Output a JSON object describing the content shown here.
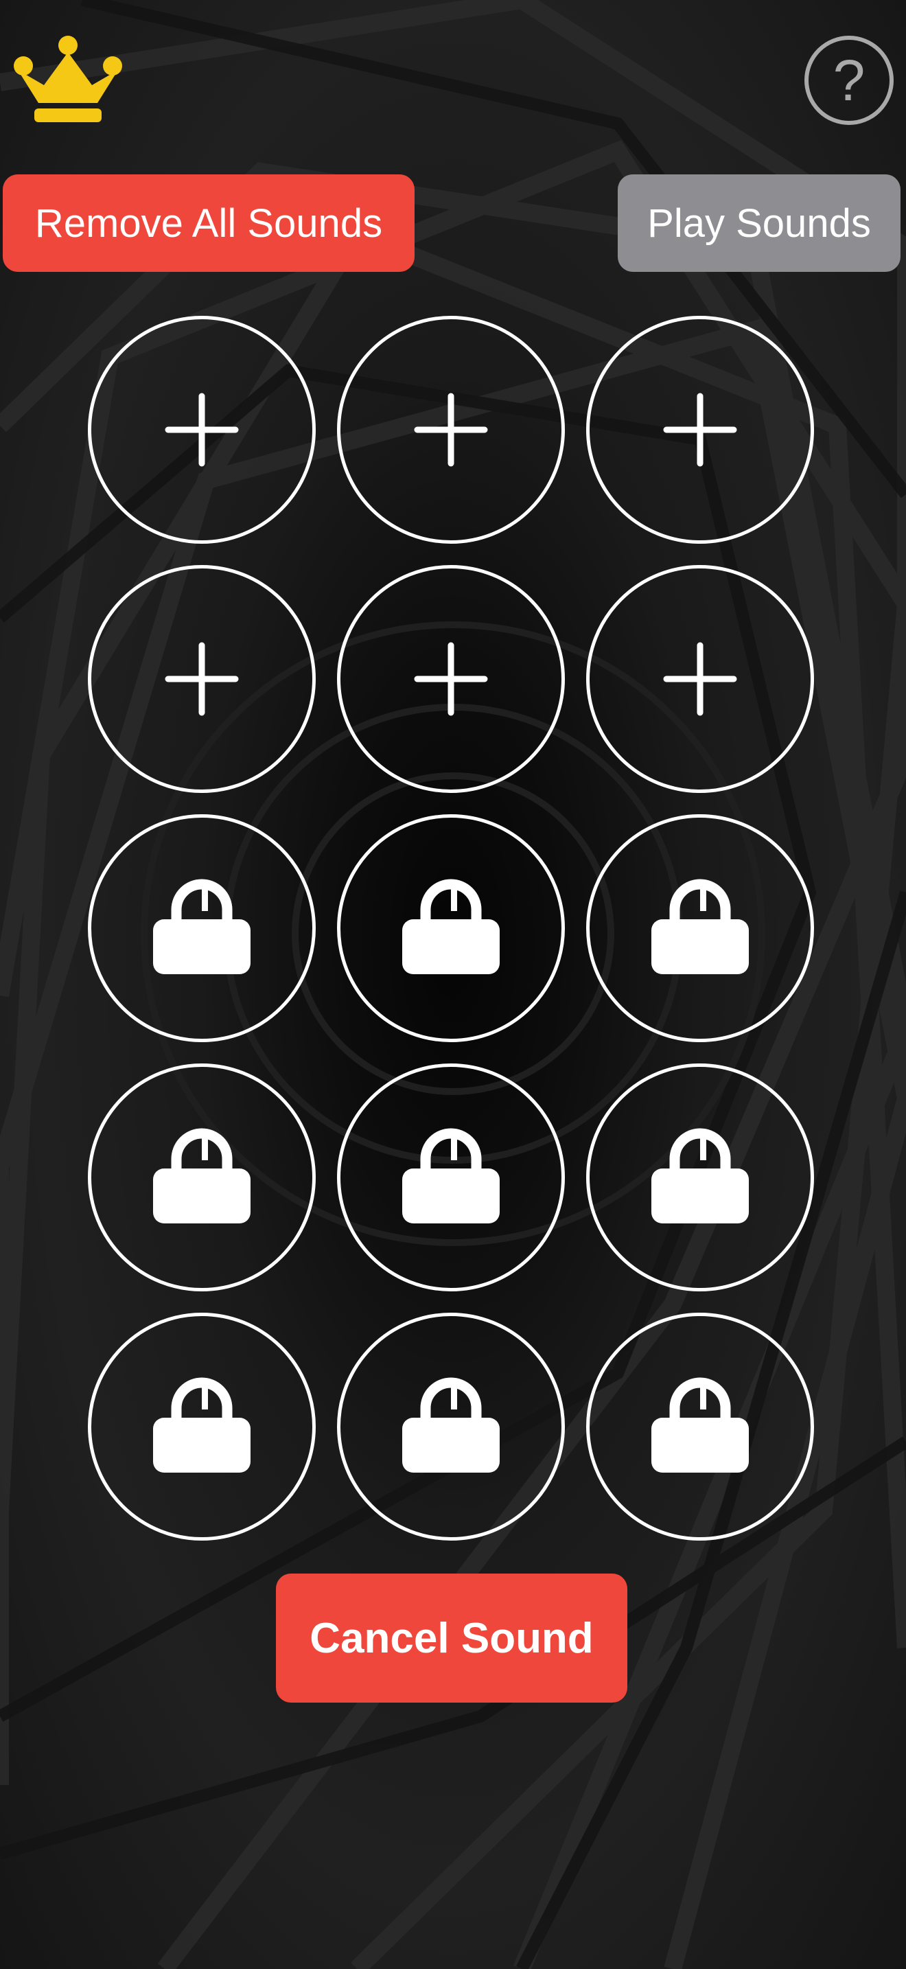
{
  "header": {
    "crown_icon": "crown-icon",
    "crown_color": "#f5c816",
    "help_label": "?"
  },
  "toolbar": {
    "remove_all_label": "Remove All Sounds",
    "play_label": "Play Sounds"
  },
  "slots": [
    {
      "state": "add",
      "icon": "plus-icon"
    },
    {
      "state": "add",
      "icon": "plus-icon"
    },
    {
      "state": "add",
      "icon": "plus-icon"
    },
    {
      "state": "add",
      "icon": "plus-icon"
    },
    {
      "state": "add",
      "icon": "plus-icon"
    },
    {
      "state": "add",
      "icon": "plus-icon"
    },
    {
      "state": "locked",
      "icon": "lock-icon"
    },
    {
      "state": "locked",
      "icon": "lock-icon"
    },
    {
      "state": "locked",
      "icon": "lock-icon"
    },
    {
      "state": "locked",
      "icon": "lock-icon"
    },
    {
      "state": "locked",
      "icon": "lock-icon"
    },
    {
      "state": "locked",
      "icon": "lock-icon"
    },
    {
      "state": "locked",
      "icon": "lock-icon"
    },
    {
      "state": "locked",
      "icon": "lock-icon"
    },
    {
      "state": "locked",
      "icon": "lock-icon"
    }
  ],
  "footer": {
    "cancel_label": "Cancel Sound"
  },
  "colors": {
    "accent_red": "#f0473c",
    "disabled_gray": "#8e8e92",
    "help_gray": "#a9a9a9",
    "slot_border": "#ffffff"
  }
}
